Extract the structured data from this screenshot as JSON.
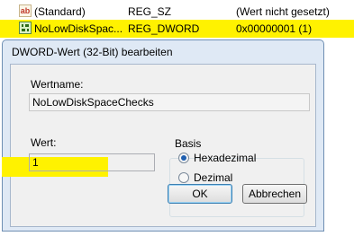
{
  "registry_list": {
    "rows": [
      {
        "icon": "string-value-icon",
        "icon_text": "ab",
        "name": "(Standard)",
        "type": "REG_SZ",
        "value": "(Wert nicht gesetzt)"
      },
      {
        "icon": "binary-value-icon",
        "name": "NoLowDiskSpac...",
        "type": "REG_DWORD",
        "value": "0x00000001 (1)"
      }
    ]
  },
  "dialog": {
    "title": "DWORD-Wert (32-Bit) bearbeiten",
    "value_name_label": "Wertname:",
    "value_name": "NoLowDiskSpaceChecks",
    "value_data_label": "Wert:",
    "value_data": "1",
    "base_label": "Basis",
    "base_options": [
      {
        "label": "Hexadezimal",
        "selected": true
      },
      {
        "label": "Dezimal",
        "selected": false
      }
    ],
    "ok_label": "OK",
    "cancel_label": "Abbrechen"
  },
  "colors": {
    "highlight": "#fff200",
    "dialog_frame": "#dfe9f5",
    "radio_selected": "#1f5fb0"
  }
}
